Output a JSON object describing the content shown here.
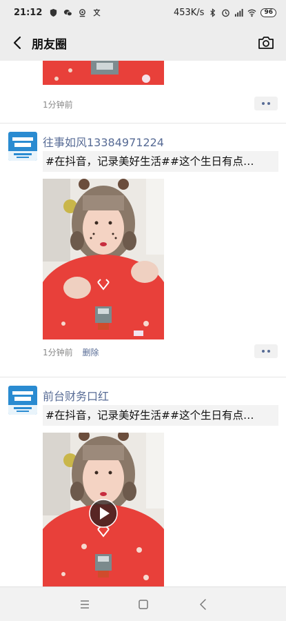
{
  "status_bar": {
    "time": "21:12",
    "speed": "453K/s",
    "battery": "96",
    "icons": [
      "shield-icon",
      "wechat-icon",
      "location-icon",
      "translate-icon",
      "bluetooth-icon",
      "alarm-icon",
      "signal-icon",
      "wifi-icon"
    ]
  },
  "header": {
    "title": "朋友圈"
  },
  "feed": {
    "posts": [
      {
        "time": "1分钟前"
      },
      {
        "name": "往事如风13384971224",
        "text": "#在抖音，记录美好生活##这个生日有点…",
        "time": "1分钟前",
        "delete_label": "删除"
      },
      {
        "name": "前台财务口红",
        "text": "#在抖音，记录美好生活##这个生日有点…"
      }
    ]
  },
  "colors": {
    "link": "#576b95",
    "sweater": "#e8403a",
    "bar_bg": "#ededed"
  }
}
